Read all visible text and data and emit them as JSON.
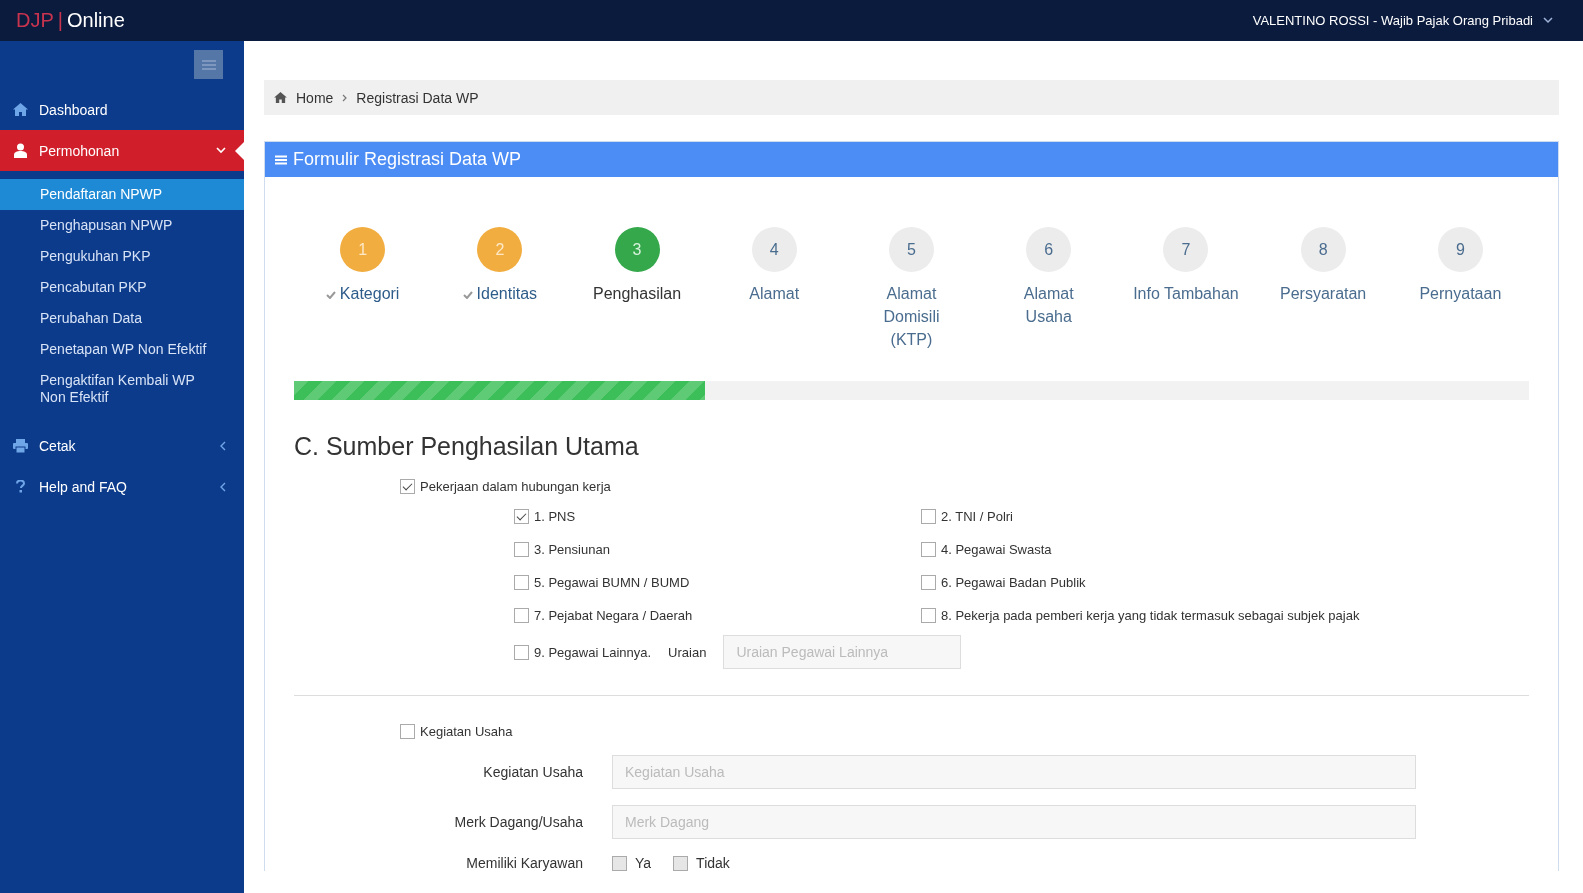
{
  "topbar": {
    "logo_left": "DJP",
    "logo_sep": "|",
    "logo_right": "Online",
    "user": "VALENTINO ROSSI - Wajib Pajak Orang Pribadi"
  },
  "sidebar": {
    "items": [
      {
        "label": "Dashboard",
        "selected": false
      },
      {
        "label": "Permohonan",
        "selected": true,
        "expanded": true,
        "children": [
          {
            "label": "Pendaftaran NPWP",
            "selected": true
          },
          {
            "label": "Penghapusan NPWP",
            "selected": false
          },
          {
            "label": "Pengukuhan PKP",
            "selected": false
          },
          {
            "label": "Pencabutan PKP",
            "selected": false
          },
          {
            "label": "Perubahan Data",
            "selected": false
          },
          {
            "label": "Penetapan WP Non Efektif",
            "selected": false
          },
          {
            "label": "Pengaktifan Kembali WP Non Efektif",
            "selected": false
          }
        ]
      },
      {
        "label": "Cetak",
        "selected": false,
        "expanded": false
      },
      {
        "label": "Help and FAQ",
        "selected": false,
        "expanded": false
      }
    ]
  },
  "breadcrumb": [
    "Home",
    "Registrasi Data WP"
  ],
  "panel_title": "Formulir Registrasi Data WP",
  "steps": [
    {
      "number": "1",
      "label": "Kategori",
      "completed": true,
      "selected": false
    },
    {
      "number": "2",
      "label": "Identitas",
      "completed": true,
      "selected": false
    },
    {
      "number": "3",
      "label": "Penghasilan",
      "completed": false,
      "selected": true
    },
    {
      "number": "4",
      "label": "Alamat",
      "completed": false,
      "selected": false
    },
    {
      "number": "5",
      "label": "Alamat Domisili (KTP)",
      "completed": false,
      "selected": false
    },
    {
      "number": "6",
      "label": "Alamat Usaha",
      "completed": false,
      "selected": false
    },
    {
      "number": "7",
      "label": "Info Tambahan",
      "completed": false,
      "selected": false
    },
    {
      "number": "8",
      "label": "Persyaratan",
      "completed": false,
      "selected": false
    },
    {
      "number": "9",
      "label": "Pernyataan",
      "completed": false,
      "selected": false
    }
  ],
  "progress": {
    "level": 0.333
  },
  "section_title": "C. Sumber Penghasilan Utama",
  "employment": {
    "label": "Pekerjaan dalam hubungan kerja",
    "checked": true,
    "options": [
      {
        "label": "1. PNS",
        "checked": true
      },
      {
        "label": "2. TNI / Polri",
        "checked": false
      },
      {
        "label": "3. Pensiunan",
        "checked": false
      },
      {
        "label": "4. Pegawai Swasta",
        "checked": false
      },
      {
        "label": "5. Pegawai BUMN / BUMD",
        "checked": false
      },
      {
        "label": "6. Pegawai Badan Publik",
        "checked": false
      },
      {
        "label": "7. Pejabat Negara / Daerah",
        "checked": false
      },
      {
        "label": "8. Pekerja pada pemberi kerja yang tidak termasuk sebagai subjek pajak",
        "checked": false
      }
    ],
    "other": {
      "label": "9. Pegawai Lainnya.",
      "checked": false,
      "field_label": "Uraian",
      "placeholder": "Uraian Pegawai Lainnya"
    }
  },
  "business": {
    "label": "Kegiatan Usaha",
    "checked": false,
    "fields": [
      {
        "label": "Kegiatan Usaha",
        "placeholder": "Kegiatan Usaha"
      },
      {
        "label": "Merk Dagang/Usaha",
        "placeholder": "Merk Dagang"
      }
    ],
    "employees": {
      "label": "Memiliki Karyawan",
      "options": [
        {
          "label": "Ya",
          "checked": false,
          "disabled": true
        },
        {
          "label": "Tidak",
          "checked": false,
          "disabled": true
        }
      ]
    }
  }
}
